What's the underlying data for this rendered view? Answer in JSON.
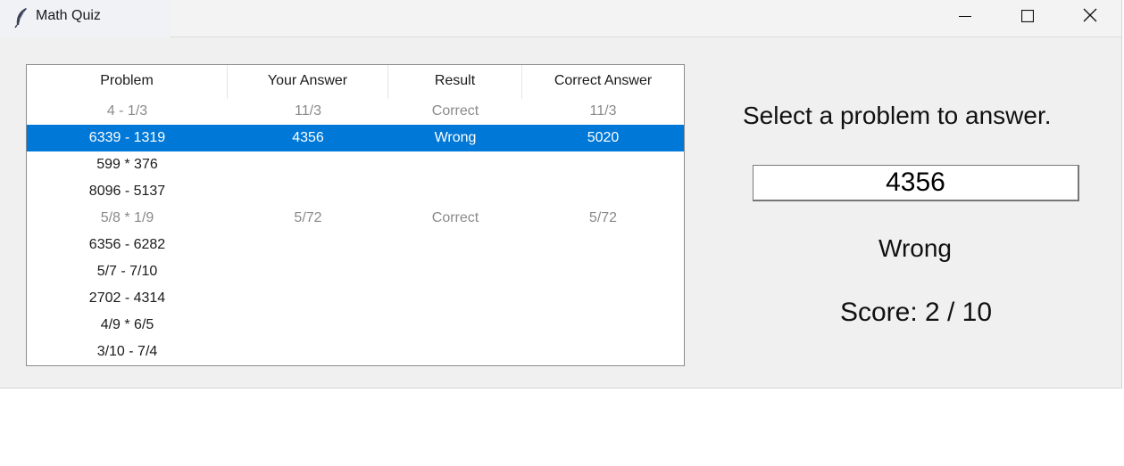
{
  "window": {
    "title": "Math Quiz",
    "icon": "feather-icon",
    "controls": [
      "minimize-icon",
      "maximize-icon",
      "close-icon"
    ]
  },
  "table": {
    "columns": [
      "Problem",
      "Your Answer",
      "Result",
      "Correct Answer"
    ],
    "rows": [
      {
        "problem": "4 - 1/3",
        "your_answer": "11/3",
        "result": "Correct",
        "correct_answer": "11/3",
        "state": "done"
      },
      {
        "problem": "6339 - 1319",
        "your_answer": "4356",
        "result": "Wrong",
        "correct_answer": "5020",
        "state": "selected"
      },
      {
        "problem": "599 * 376",
        "your_answer": "",
        "result": "",
        "correct_answer": "",
        "state": "open"
      },
      {
        "problem": "8096 - 5137",
        "your_answer": "",
        "result": "",
        "correct_answer": "",
        "state": "open"
      },
      {
        "problem": "5/8 * 1/9",
        "your_answer": "5/72",
        "result": "Correct",
        "correct_answer": "5/72",
        "state": "done"
      },
      {
        "problem": "6356 - 6282",
        "your_answer": "",
        "result": "",
        "correct_answer": "",
        "state": "open"
      },
      {
        "problem": "5/7 - 7/10",
        "your_answer": "",
        "result": "",
        "correct_answer": "",
        "state": "open"
      },
      {
        "problem": "2702 - 4314",
        "your_answer": "",
        "result": "",
        "correct_answer": "",
        "state": "open"
      },
      {
        "problem": "4/9 * 6/5",
        "your_answer": "",
        "result": "",
        "correct_answer": "",
        "state": "open"
      },
      {
        "problem": "3/10 - 7/4",
        "your_answer": "",
        "result": "",
        "correct_answer": "",
        "state": "open"
      }
    ]
  },
  "panel": {
    "prompt": "Select a problem to answer.",
    "answer_value": "4356",
    "result": "Wrong",
    "score": "Score: 2 / 10"
  },
  "colors": {
    "selection": "#0078d7",
    "done_text": "#8a8a8a"
  }
}
